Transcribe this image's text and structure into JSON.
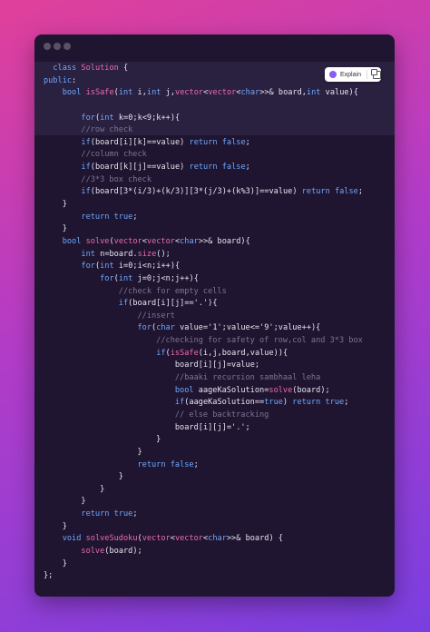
{
  "toolbar": {
    "explain_label": "Explain"
  },
  "code_lines": [
    "  class Solution {",
    "public:",
    "    bool isSafe(int i,int j,vector<vector<char>>& board,int value){",
    "",
    "        for(int k=0;k<9;k++){",
    "        //row check",
    "        if(board[i][k]==value) return false;",
    "        //column check",
    "        if(board[k][j]==value) return false;",
    "        //3*3 box check",
    "        if(board[3*(i/3)+(k/3)][3*(j/3)+(k%3)]==value) return false;",
    "    }",
    "        return true;",
    "    }",
    "    bool solve(vector<vector<char>>& board){",
    "        int n=board.size();",
    "        for(int i=0;i<n;i++){",
    "            for(int j=0;j<n;j++){",
    "                //check for empty cells",
    "                if(board[i][j]=='.'){",
    "                    //insert",
    "                    for(char value='1';value<='9';value++){",
    "                        //checking for safety of row,col and 3*3 box",
    "                        if(isSafe(i,j,board,value)){",
    "                            board[i][j]=value;",
    "                            //baaki recursion sambhaal leha",
    "                            bool aageKaSolution=solve(board);",
    "                            if(aageKaSolution==true) return true;",
    "                            // else backtracking",
    "                            board[i][j]='.';",
    "                        }",
    "                    }",
    "                    return false;",
    "                }",
    "            }",
    "        }",
    "        return true;",
    "    }",
    "    void solveSudoku(vector<vector<char>>& board) {",
    "        solve(board);",
    "    }",
    "};"
  ]
}
